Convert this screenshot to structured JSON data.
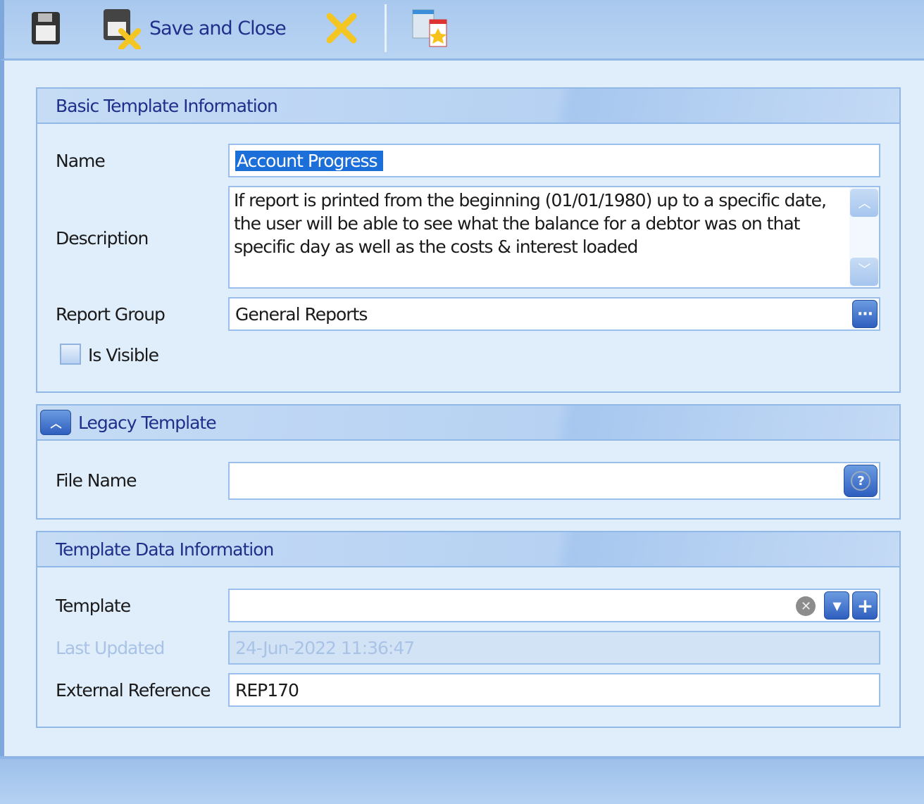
{
  "toolbar": {
    "save_icon": "save-icon",
    "save_close_label": "Save and Close",
    "cancel_icon": "close-icon",
    "report_icon": "report-designer-icon"
  },
  "basic": {
    "title": "Basic Template Information",
    "name_label": "Name",
    "name_value": "Account Progress",
    "description_label": "Description",
    "description_value": "If report is printed from the beginning (01/01/1980)  up to a specific date, the user will be able to see what the balance for a debtor was on that specific day as well as the costs & interest loaded",
    "report_group_label": "Report Group",
    "report_group_value": "General Reports",
    "is_visible_label": "Is Visible",
    "is_visible_checked": false
  },
  "legacy": {
    "title": "Legacy Template",
    "file_name_label": "File Name",
    "file_name_value": ""
  },
  "data": {
    "title": "Template Data Information",
    "template_label": "Template",
    "template_value": "",
    "last_updated_label": "Last Updated",
    "last_updated_value": "24-Jun-2022 11:36:47",
    "external_ref_label": "External Reference",
    "external_ref_value": "REP170"
  },
  "colors": {
    "accent": "#1f2f8a",
    "border": "#92b8e8",
    "background": "#e0eefc"
  }
}
